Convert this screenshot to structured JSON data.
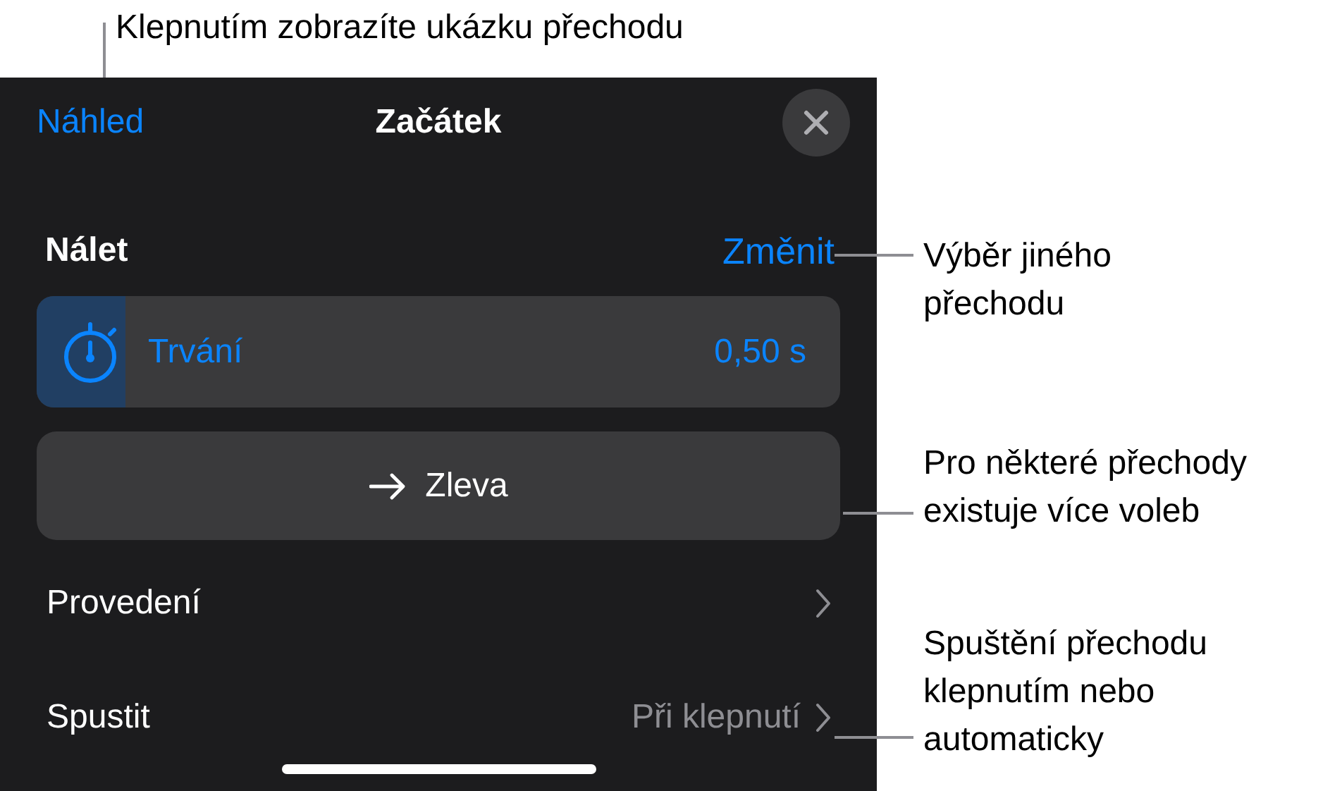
{
  "header": {
    "left_link": "Náhled",
    "title": "Začátek"
  },
  "transition": {
    "name": "Nálet",
    "change_link": "Změnit"
  },
  "duration": {
    "label": "Trvání",
    "value": "0,50 s",
    "level": 0.11
  },
  "direction": {
    "label": "Zleva"
  },
  "rows": [
    {
      "label": "Provedení"
    },
    {
      "label": "Spustit",
      "value": "Při klepnutí"
    }
  ],
  "callouts": [
    {
      "kind": "top",
      "text": "Klepnutím zobrazíte ukázku přechodu"
    },
    {
      "kind": "side",
      "text": "Výběr jiného přechodu"
    },
    {
      "kind": "side",
      "text": "Pro některé přechody existuje více voleb"
    },
    {
      "kind": "side",
      "text": "Spuštění přechodu klepnutím nebo automaticky"
    }
  ]
}
